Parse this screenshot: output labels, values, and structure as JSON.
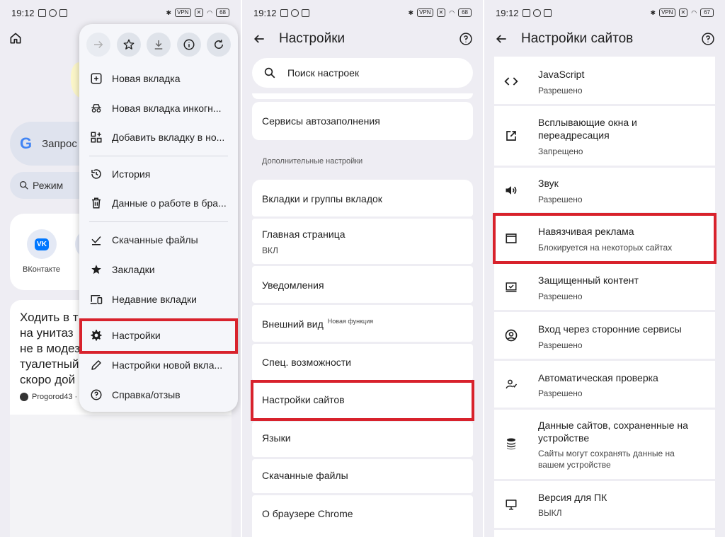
{
  "status": {
    "time": "19:12",
    "vpn": "VPN",
    "battery_left": "68",
    "battery_mid": "68",
    "battery_right": "67"
  },
  "panel1": {
    "search_text": "Запрос",
    "ai_mode_label": "Режим",
    "shortcut_vk_label": "ВКонтакте",
    "vk_logo": "VK",
    "article_lines": [
      "Ходить в т",
      "на унитаз",
      "не в модез",
      "туалетный",
      "скоро дой"
    ],
    "article_source": "Progorod43 ·",
    "menu": {
      "toolbar_icons": [
        "forward-arrow-icon",
        "star-icon",
        "download-icon",
        "info-icon",
        "reload-icon"
      ],
      "items": [
        {
          "label": "Новая вкладка",
          "icon": "plus-box-icon"
        },
        {
          "label": "Новая вкладка инкогн...",
          "icon": "incognito-icon"
        },
        {
          "label": "Добавить вкладку в но...",
          "icon": "add-group-icon"
        },
        {
          "label": "История",
          "icon": "history-icon"
        },
        {
          "label": "Данные  о работе в бра...",
          "icon": "trash-icon"
        },
        {
          "label": "Скачанные файлы",
          "icon": "download-done-icon"
        },
        {
          "label": "Закладки",
          "icon": "star-filled-icon"
        },
        {
          "label": "Недавние вкладки",
          "icon": "devices-icon"
        },
        {
          "label": "Настройки",
          "icon": "gear-icon"
        },
        {
          "label": "Настройки новой вкла...",
          "icon": "pencil-icon"
        },
        {
          "label": "Справка/отзыв",
          "icon": "help-icon"
        }
      ]
    }
  },
  "panel2": {
    "title": "Настройки",
    "search_placeholder": "Поиск настроек",
    "autofill": "Сервисы автозаполнения",
    "section_header": "Дополнительные настройки",
    "tabs_groups": "Вкладки и группы вкладок",
    "home_page": "Главная страница",
    "home_page_value": "ВКЛ",
    "notifications": "Уведомления",
    "appearance": "Внешний вид",
    "appearance_badge": "Новая функция",
    "accessibility": "Спец. возможности",
    "site_settings": "Настройки сайтов",
    "languages": "Языки",
    "downloads": "Скачанные файлы",
    "about": "О браузере Chrome"
  },
  "panel3": {
    "title": "Настройки сайтов",
    "rows": [
      {
        "title": "JavaScript",
        "sub": "Разрешено",
        "icon": "code-icon"
      },
      {
        "title": "Всплывающие окна и переадресация",
        "sub": "Запрещено",
        "icon": "open-external-icon"
      },
      {
        "title": "Звук",
        "sub": "Разрешено",
        "icon": "volume-icon"
      },
      {
        "title": "Навязчивая реклама",
        "sub": "Блокируется на некоторых сайтах",
        "icon": "ad-window-icon"
      },
      {
        "title": "Защищенный контент",
        "sub": "Разрешено",
        "icon": "protected-content-icon"
      },
      {
        "title": "Вход через сторонние сервисы",
        "sub": "Разрешено",
        "icon": "account-circle-icon"
      },
      {
        "title": "Автоматическая проверка",
        "sub": "Разрешено",
        "icon": "person-check-icon"
      },
      {
        "title": "Данные сайтов, сохраненные на устройстве",
        "sub": "Сайты могут сохранять данные на вашем устройстве",
        "icon": "database-icon"
      },
      {
        "title": "Версия для ПК",
        "sub": "ВЫКЛ",
        "icon": "desktop-icon"
      }
    ]
  },
  "colors": {
    "highlight": "#d8222c",
    "panel_bg": "#eeedf3",
    "card_bg": "#ffffff"
  }
}
